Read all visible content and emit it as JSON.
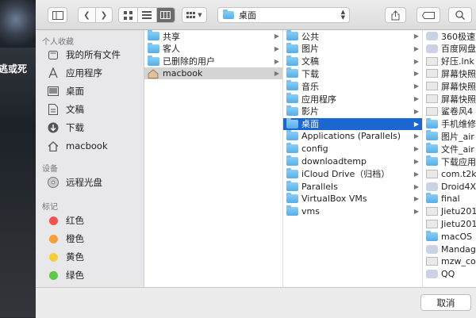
{
  "background": {
    "overlay_text": "逃或死"
  },
  "toolbar": {
    "path_label": "桌面"
  },
  "sidebar": {
    "favorites_title": "个人收藏",
    "favorites": [
      {
        "label": "我的所有文件",
        "icon": "all-files-icon"
      },
      {
        "label": "应用程序",
        "icon": "applications-icon"
      },
      {
        "label": "桌面",
        "icon": "desktop-icon"
      },
      {
        "label": "文稿",
        "icon": "documents-icon"
      },
      {
        "label": "下载",
        "icon": "downloads-icon"
      },
      {
        "label": "macbook",
        "icon": "home-icon"
      }
    ],
    "devices_title": "设备",
    "devices": [
      {
        "label": "远程光盘",
        "icon": "disc-icon"
      }
    ],
    "tags_title": "标记",
    "tags": [
      {
        "label": "红色",
        "color": "#f0524d"
      },
      {
        "label": "橙色",
        "color": "#f4a03a"
      },
      {
        "label": "黄色",
        "color": "#f5cf3b"
      },
      {
        "label": "绿色",
        "color": "#5fc84a"
      }
    ]
  },
  "column1": [
    {
      "label": "共享",
      "kind": "folder"
    },
    {
      "label": "客人",
      "kind": "folder"
    },
    {
      "label": "已删除的用户",
      "kind": "folder"
    },
    {
      "label": "macbook",
      "kind": "home",
      "state": "grey"
    }
  ],
  "column2": [
    {
      "label": "公共"
    },
    {
      "label": "图片"
    },
    {
      "label": "文稿"
    },
    {
      "label": "下载"
    },
    {
      "label": "音乐"
    },
    {
      "label": "应用程序"
    },
    {
      "label": "影片"
    },
    {
      "label": "桌面",
      "state": "selected"
    },
    {
      "label": "Applications (Parallels)"
    },
    {
      "label": "config"
    },
    {
      "label": "downloadtemp"
    },
    {
      "label": "iCloud Drive（归档）"
    },
    {
      "label": "Parallels"
    },
    {
      "label": "VirtualBox VMs"
    },
    {
      "label": "vms"
    }
  ],
  "column3": [
    {
      "label": "360极速",
      "kind": "app"
    },
    {
      "label": "百度网盘",
      "kind": "app"
    },
    {
      "label": "好压.lnk",
      "kind": "doc"
    },
    {
      "label": "屏幕快照",
      "kind": "doc"
    },
    {
      "label": "屏幕快照",
      "kind": "doc"
    },
    {
      "label": "屏幕快照",
      "kind": "doc"
    },
    {
      "label": "鲨卷风4",
      "kind": "doc"
    },
    {
      "label": "手机维修",
      "kind": "folder"
    },
    {
      "label": "图片_air",
      "kind": "folder"
    },
    {
      "label": "文件_air",
      "kind": "folder"
    },
    {
      "label": "下载应用",
      "kind": "folder"
    },
    {
      "label": "com.t2k",
      "kind": "doc"
    },
    {
      "label": "Droid4X",
      "kind": "app"
    },
    {
      "label": "final",
      "kind": "folder"
    },
    {
      "label": "Jietu201",
      "kind": "doc"
    },
    {
      "label": "Jietu201",
      "kind": "doc"
    },
    {
      "label": "macOS",
      "kind": "folder"
    },
    {
      "label": "Mandag",
      "kind": "app"
    },
    {
      "label": "mzw_co",
      "kind": "doc"
    },
    {
      "label": "QQ",
      "kind": "app"
    }
  ],
  "footer": {
    "cancel_label": "取消"
  },
  "colors": {
    "selection": "#1a67d2",
    "folder": "#6bbcf0"
  }
}
